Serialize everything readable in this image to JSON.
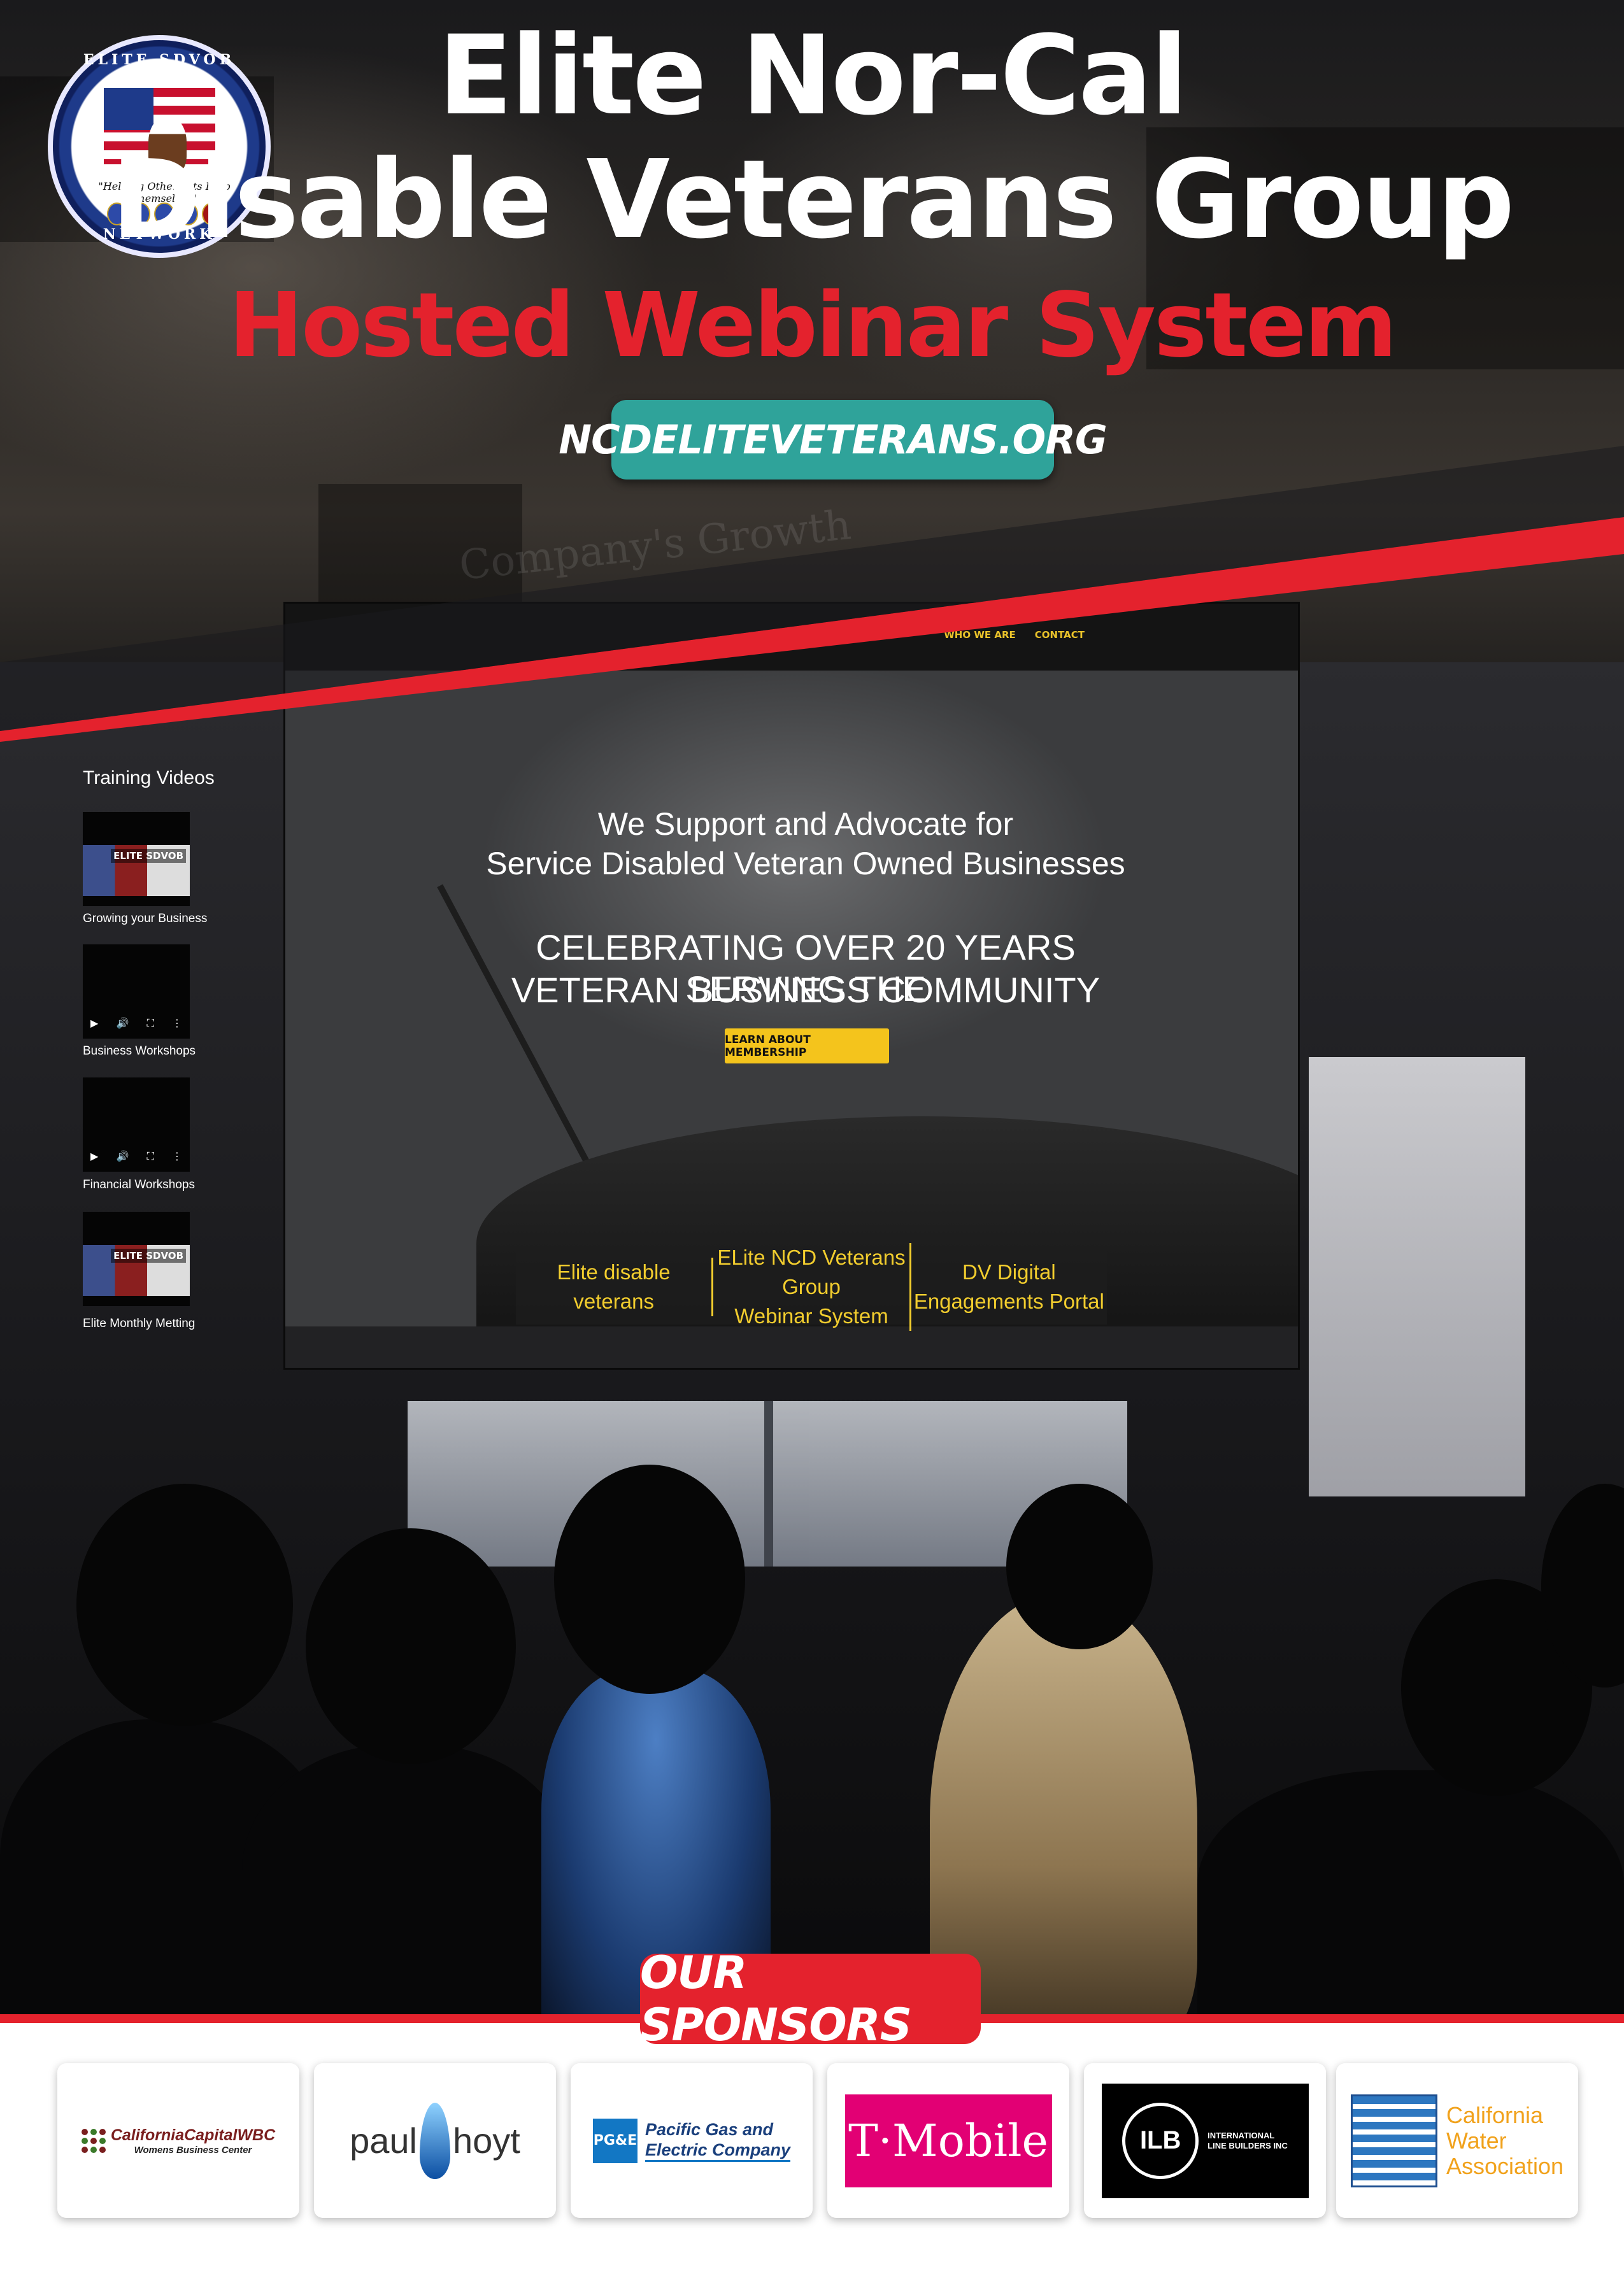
{
  "header": {
    "logo": {
      "ring_top": "ELITE SDVOB",
      "motto": "\"Helping Other Vets Help Themselves\"",
      "ring_bottom": "NETWORK"
    },
    "title_line1": "Elite Nor-Cal",
    "title_line2": "Disable Veterans Group",
    "subtitle": "Hosted Webinar System",
    "url": "NCDELITEVETERANS.ORG",
    "background_text": "Company's Growth"
  },
  "screen": {
    "nav": [
      "WHO WE ARE",
      "CONTACT"
    ],
    "training_heading": "Training Videos",
    "videos": [
      {
        "caption": "Growing your Business",
        "thumb_label": "ELITE SDVOB"
      },
      {
        "caption": "Business Workshops",
        "thumb_label": ""
      },
      {
        "caption": "Financial Workshops",
        "thumb_label": ""
      },
      {
        "caption": "Elite Monthly Metting",
        "thumb_label": "ELITE SDVOB"
      }
    ],
    "hero_line1": "We Support and Advocate for",
    "hero_line2": "Service Disabled Veteran Owned Businesses",
    "hero_line3": "CELEBRATING OVER 20 YEARS SERVING THE",
    "hero_line4": "VETERAN BUSINESS COMMUNITY",
    "cta": "LEARN ABOUT MEMBERSHIP",
    "portals": [
      {
        "line1": "Elite disable",
        "line2": "veterans"
      },
      {
        "line1": "ELite NCD Veterans Group",
        "line2": "Webinar System"
      },
      {
        "line1": "DV Digital",
        "line2": "Engagements Portal"
      }
    ]
  },
  "sponsors": {
    "heading": "OUR SPONSORS",
    "items": [
      {
        "line1": "CaliforniaCapitalWBC",
        "line2": "Womens Business Center"
      },
      {
        "left": "paul",
        "right": "hoyt"
      },
      {
        "mark": "PG&E",
        "line1": "Pacific Gas and",
        "line2": "Electric Company"
      },
      {
        "text": "T·Mobile"
      },
      {
        "mark": "ILB",
        "line1": "INTERNATIONAL",
        "line2": "LINE BUILDERS INC"
      },
      {
        "line1": "California",
        "line2": "Water",
        "line3": "Association"
      }
    ]
  },
  "colors": {
    "accent_red": "#e4222d",
    "url_teal": "#2fa39a",
    "cta_yellow": "#f4c41c",
    "portal_yellow": "#f2cd2e"
  }
}
